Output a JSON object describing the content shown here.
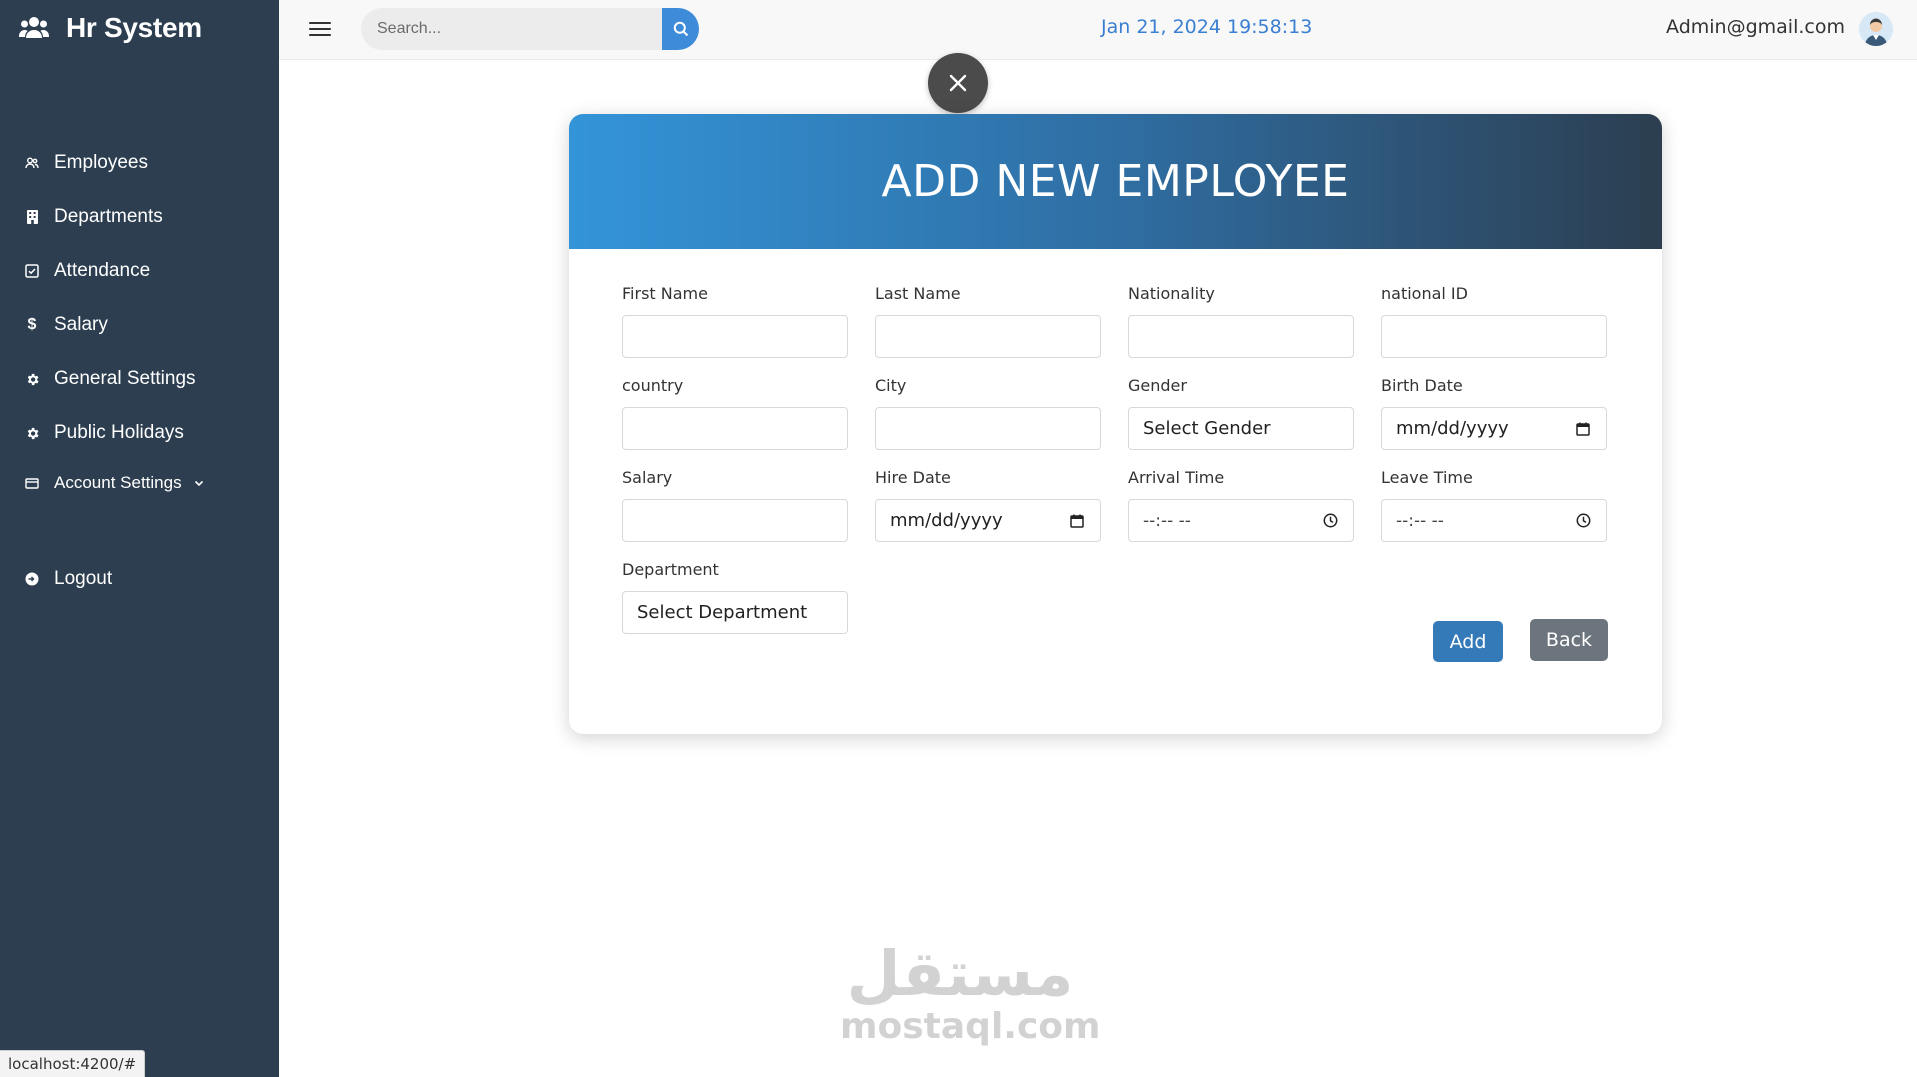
{
  "app": {
    "brand": "Hr System"
  },
  "sidebar": {
    "items": [
      {
        "label": "Employees",
        "icon": "users-icon"
      },
      {
        "label": "Departments",
        "icon": "building-icon"
      },
      {
        "label": "Attendance",
        "icon": "calendar-check-icon"
      },
      {
        "label": "Salary",
        "icon": "dollar-icon"
      },
      {
        "label": "General Settings",
        "icon": "gear-icon"
      },
      {
        "label": "Public Holidays",
        "icon": "gear-icon"
      },
      {
        "label": "Account Settings",
        "icon": "card-icon"
      },
      {
        "label": "Logout",
        "icon": "logout-icon"
      }
    ]
  },
  "topbar": {
    "search_placeholder": "Search...",
    "datetime": "Jan 21, 2024 19:58:13",
    "user_email": "Admin@gmail.com"
  },
  "form": {
    "title": "ADD NEW EMPLOYEE",
    "fields": {
      "first_name": {
        "label": "First Name",
        "value": ""
      },
      "last_name": {
        "label": "Last Name",
        "value": ""
      },
      "nationality": {
        "label": "Nationality",
        "value": ""
      },
      "national_id": {
        "label": "national ID",
        "value": ""
      },
      "country": {
        "label": "country",
        "value": ""
      },
      "city": {
        "label": "City",
        "value": ""
      },
      "gender": {
        "label": "Gender",
        "value": "Select Gender"
      },
      "birth_date": {
        "label": "Birth Date",
        "value": "mm/dd/yyyy"
      },
      "salary": {
        "label": "Salary",
        "value": ""
      },
      "hire_date": {
        "label": "Hire Date",
        "value": "mm/dd/yyyy"
      },
      "arrival_time": {
        "label": "Arrival Time",
        "value": "--:-- --"
      },
      "leave_time": {
        "label": "Leave Time",
        "value": "--:-- --"
      },
      "department": {
        "label": "Department",
        "value": "Select Department"
      }
    },
    "add_label": "Add",
    "back_label": "Back"
  },
  "status_bar": {
    "url": "localhost:4200/#"
  },
  "watermark": {
    "arabic": "مستقل",
    "latin": "mostaql.com"
  },
  "colors": {
    "sidebar_bg": "#2c3e50",
    "accent": "#3d8bd9",
    "header_gradient_start": "#3394d8",
    "header_gradient_end": "#2c3e50",
    "add_button": "#3479b8",
    "back_button": "#6c757d",
    "clock_text": "#3a7fd2"
  }
}
